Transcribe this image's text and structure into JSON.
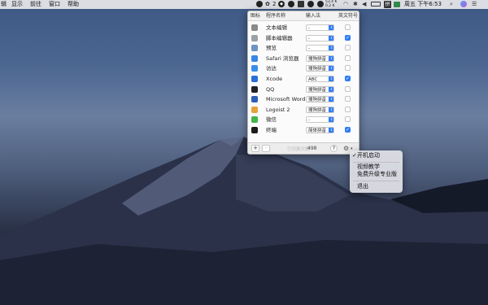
{
  "menubar": {
    "items": [
      "辑",
      "显示",
      "前往",
      "窗口",
      "帮助"
    ],
    "notification_count": "2",
    "network_up": "53.4 K",
    "network_down": "0.2 K",
    "input_indicator": "拼",
    "datetime": "周五 下午6:53"
  },
  "panel": {
    "columns": {
      "icon": "图标",
      "app": "程序名称",
      "input": "输入法",
      "punct": "英文符号"
    },
    "rows": [
      {
        "name": "文本编辑",
        "input": "-",
        "checked": false,
        "icon": "textedit-icon",
        "color": "#8a8a8a"
      },
      {
        "name": "脚本编辑器",
        "input": "-",
        "checked": true,
        "icon": "script-editor-icon",
        "color": "#9aa0a8"
      },
      {
        "name": "预览",
        "input": "-",
        "checked": false,
        "icon": "preview-icon",
        "color": "#6e93c4"
      },
      {
        "name": "Safari 浏览器",
        "input": "搜狗拼音",
        "checked": false,
        "icon": "safari-icon",
        "color": "#3a86e6"
      },
      {
        "name": "访达",
        "input": "搜狗拼音",
        "checked": false,
        "icon": "finder-icon",
        "color": "#3d8ee8"
      },
      {
        "name": "Xcode",
        "input": "ABC",
        "checked": true,
        "icon": "xcode-icon",
        "color": "#2a6fd8"
      },
      {
        "name": "QQ",
        "input": "搜狗拼音",
        "checked": false,
        "icon": "qq-icon",
        "color": "#222222"
      },
      {
        "name": "Microsoft Word",
        "input": "搜狗拼音",
        "checked": false,
        "icon": "word-icon",
        "color": "#2b5fb4"
      },
      {
        "name": "Logoist 2",
        "input": "搜狗拼音",
        "checked": false,
        "icon": "logoist-icon",
        "color": "#e6a23a"
      },
      {
        "name": "微信",
        "input": "-",
        "checked": false,
        "icon": "wechat-icon",
        "color": "#44b549"
      },
      {
        "name": "终端",
        "input": "简体拼音",
        "checked": true,
        "icon": "terminal-icon",
        "color": "#1c1c1c"
      }
    ],
    "footer": {
      "add": "+",
      "remove": "-",
      "serial_label": "已切换次数:",
      "serial_value": "498",
      "help": "?",
      "gear": "⚙"
    }
  },
  "dropdown": {
    "items": [
      "开机启动",
      "视频教学",
      "免费升级专业版",
      "退出"
    ],
    "checked_mark": "✓"
  },
  "colors": {
    "accent": "#2e7cf6",
    "menubar": "#e8e8ec"
  }
}
